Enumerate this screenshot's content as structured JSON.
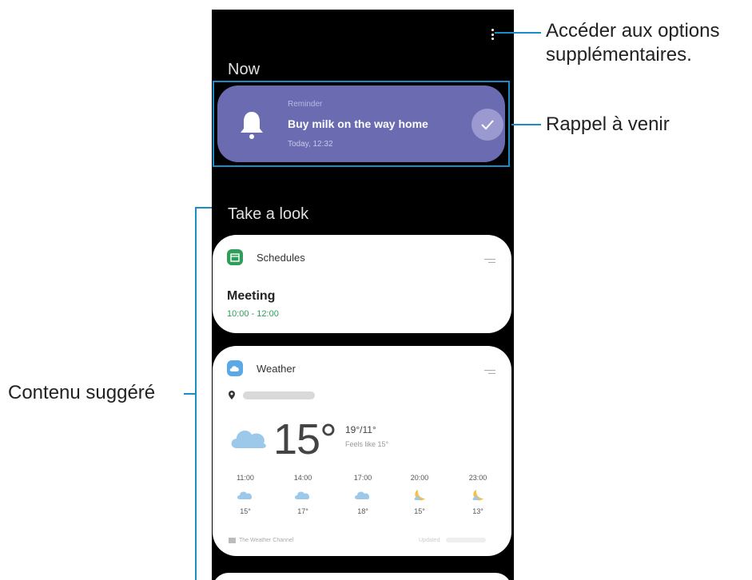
{
  "now_section": {
    "title": "Now"
  },
  "reminder": {
    "kicker": "Reminder",
    "title": "Buy milk on the way home",
    "time": "Today, 12:32"
  },
  "take_a_look": {
    "title": "Take a look"
  },
  "schedules": {
    "app_name": "Schedules",
    "event_title": "Meeting",
    "event_time": "10:00 - 12:00"
  },
  "weather": {
    "app_name": "Weather",
    "current_temp": "15°",
    "high_low": "19°/11°",
    "feels_like": "Feels like 15°",
    "hourly": [
      {
        "time": "11:00",
        "icon": "cloud-icon",
        "temp": "15°"
      },
      {
        "time": "14:00",
        "icon": "cloud-icon",
        "temp": "17°"
      },
      {
        "time": "17:00",
        "icon": "cloud-icon",
        "temp": "18°"
      },
      {
        "time": "20:00",
        "icon": "moon-icon",
        "temp": "15°"
      },
      {
        "time": "23:00",
        "icon": "moon-icon",
        "temp": "13°"
      }
    ],
    "source": "The Weather Channel",
    "updated": "Updated"
  },
  "callouts": {
    "more_options_line1": "Accéder aux options",
    "more_options_line2": "supplémentaires.",
    "upcoming_reminder": "Rappel à venir",
    "suggested_content": "Contenu suggéré"
  },
  "colors": {
    "reminder_bg": "#6a6bb0",
    "callout_line": "#1a8cc8",
    "schedule_green": "#2e9e5a",
    "weather_blue": "#5aa9e6"
  }
}
